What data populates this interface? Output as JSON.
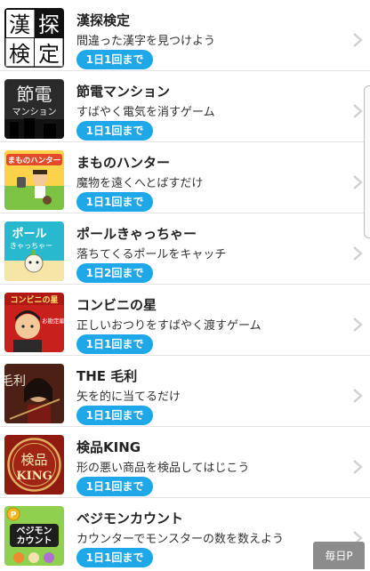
{
  "games": [
    {
      "title": "漢探検定",
      "desc": "間違った漢字を見つけよう",
      "badge": "1日1回まで",
      "icon": "kanji-kentei-icon",
      "icon_text": [
        "漢",
        "探",
        "検",
        "定"
      ]
    },
    {
      "title": "節電マンション",
      "desc": "すばやく電気を消すゲーム",
      "badge": "1日1回まで",
      "icon": "setsuden-mansion-icon",
      "icon_text": [
        "節電",
        "マンション"
      ]
    },
    {
      "title": "まものハンター",
      "desc": "魔物を遠くへとばすだけ",
      "badge": "1日1回まで",
      "icon": "mamono-hunter-icon",
      "icon_text": [
        "まものハンター"
      ]
    },
    {
      "title": "ポールきゃっちゃー",
      "desc": "落ちてくるポールをキャッチ",
      "badge": "1日2回まで",
      "icon": "pole-catcher-icon",
      "icon_text": [
        "ポール",
        "きゃっちゃー"
      ]
    },
    {
      "title": "コンビニの星",
      "desc": "正しいおつりをすばやく渡すゲーム",
      "badge": "1日1回まで",
      "icon": "konbini-no-hoshi-icon",
      "icon_text": [
        "コンビニの星",
        "お勘定編"
      ]
    },
    {
      "title": "THE 毛利",
      "desc": "矢を的に当てるだけ",
      "badge": "1日1回まで",
      "icon": "the-mouri-icon",
      "icon_text": [
        "毛利"
      ]
    },
    {
      "title": "検品KING",
      "desc": "形の悪い商品を検品してはじこう",
      "badge": "1日1回まで",
      "icon": "kenpin-king-icon",
      "icon_text": [
        "検品",
        "KING"
      ]
    },
    {
      "title": "ベジモンカウント",
      "desc": "カウンターでモンスターの数を数えよう",
      "badge": "1日1回まで",
      "icon": "vegimon-count-icon",
      "icon_text": [
        "ベジモン",
        "カウント",
        "P"
      ]
    }
  ],
  "daily_button": "毎日P",
  "colors": {
    "badge": "#1ea8e8",
    "chevron": "#cfcfcf",
    "divider": "#e4e4e4",
    "daily_button": "#8c8c8c"
  }
}
